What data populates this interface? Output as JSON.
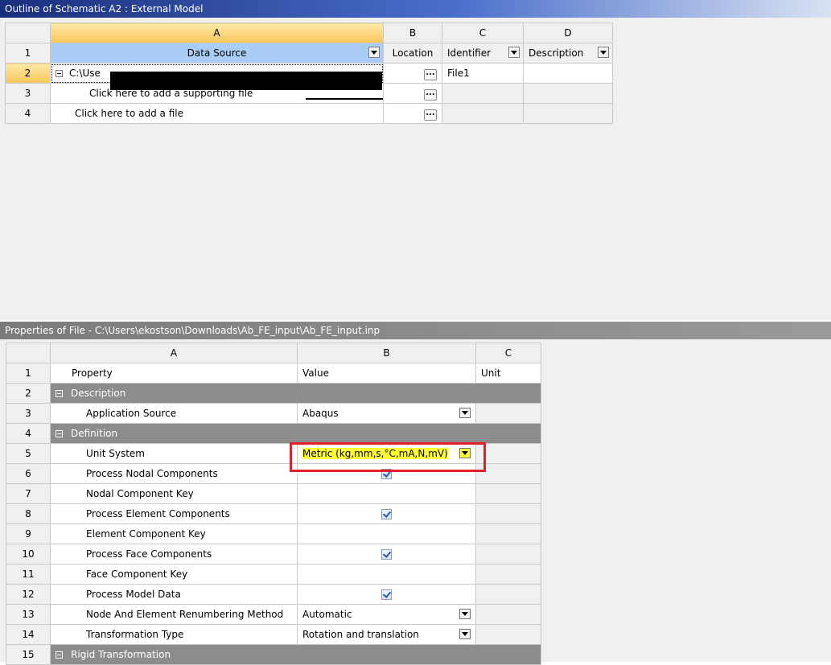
{
  "outline": {
    "title": "Outline of Schematic A2 : External Model",
    "col_headers": [
      "A",
      "B",
      "C",
      "D"
    ],
    "header_row": {
      "row_num": "1",
      "data_source": "Data Source",
      "location": "Location",
      "identifier": "Identifier",
      "description": "Description"
    },
    "rows": [
      {
        "num": "2",
        "source": "C:\\Use",
        "identifier": "File1"
      },
      {
        "num": "3",
        "source": "Click here to add a supporting file",
        "identifier": ""
      },
      {
        "num": "4",
        "source": "Click here to add a file",
        "identifier": ""
      }
    ],
    "ellipsis": "..."
  },
  "properties": {
    "title": "Properties of File - C:\\Users\\ekostson\\Downloads\\Ab_FE_input\\Ab_FE_input.inp",
    "col_headers": [
      "A",
      "B",
      "C"
    ],
    "header": {
      "num": "1",
      "property": "Property",
      "value": "Value",
      "unit": "Unit"
    },
    "rows": [
      {
        "num": "2",
        "label": "Description",
        "kind": "group"
      },
      {
        "num": "3",
        "label": "Application Source",
        "value": "Abaqus",
        "kind": "dropdown"
      },
      {
        "num": "4",
        "label": "Definition",
        "kind": "group"
      },
      {
        "num": "5",
        "label": "Unit System",
        "value": "Metric (kg,mm,s,°C,mA,N,mV)",
        "kind": "dropdown",
        "highlighted": true
      },
      {
        "num": "6",
        "label": "Process Nodal Components",
        "checked": true,
        "kind": "checkbox"
      },
      {
        "num": "7",
        "label": "Nodal Component Key",
        "value": "",
        "kind": "text"
      },
      {
        "num": "8",
        "label": "Process Element Components",
        "checked": true,
        "kind": "checkbox"
      },
      {
        "num": "9",
        "label": "Element Component Key",
        "value": "",
        "kind": "text"
      },
      {
        "num": "10",
        "label": "Process Face Components",
        "checked": true,
        "kind": "checkbox"
      },
      {
        "num": "11",
        "label": "Face Component Key",
        "value": "",
        "kind": "text"
      },
      {
        "num": "12",
        "label": "Process Model Data",
        "checked": true,
        "kind": "checkbox"
      },
      {
        "num": "13",
        "label": "Node And Element Renumbering Method",
        "value": "Automatic",
        "kind": "dropdown"
      },
      {
        "num": "14",
        "label": "Transformation Type",
        "value": "Rotation and translation",
        "kind": "dropdown"
      },
      {
        "num": "15",
        "label": "Rigid Transformation",
        "kind": "group"
      }
    ]
  },
  "colors": {
    "accent_red": "#e0202a",
    "highlight_yellow": "#ffff33",
    "selected_header": "#a9cdf5"
  }
}
